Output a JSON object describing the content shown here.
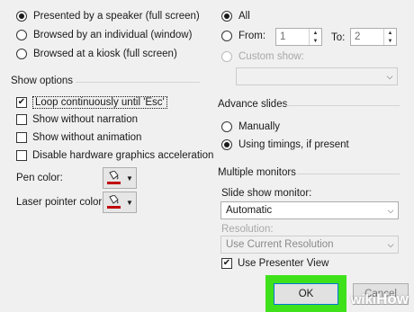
{
  "show_type": {
    "options": [
      {
        "label": "Presented by a speaker (full screen)",
        "selected": true
      },
      {
        "label": "Browsed by an individual (window)",
        "selected": false
      },
      {
        "label": "Browsed at a kiosk (full screen)",
        "selected": false
      }
    ]
  },
  "show_options": {
    "title": "Show options",
    "checks": [
      {
        "label": "Loop continuously until 'Esc'",
        "checked": true
      },
      {
        "label": "Show without narration",
        "checked": false
      },
      {
        "label": "Show without animation",
        "checked": false
      },
      {
        "label": "Disable hardware graphics acceleration",
        "checked": false
      }
    ],
    "pen_color_label": "Pen color:",
    "laser_color_label": "Laser pointer color:",
    "pen_color": "#c00000",
    "laser_color": "#c00000"
  },
  "show_slides": {
    "all_label": "All",
    "from_label": "From:",
    "from_value": "1",
    "to_label": "To:",
    "to_value": "2",
    "custom_label": "Custom show:"
  },
  "advance_slides": {
    "title": "Advance slides",
    "manually_label": "Manually",
    "timings_label": "Using timings, if present"
  },
  "monitors": {
    "title": "Multiple monitors",
    "monitor_label": "Slide show monitor:",
    "monitor_value": "Automatic",
    "resolution_label": "Resolution:",
    "resolution_value": "Use Current Resolution",
    "presenter_view_label": "Use Presenter View",
    "presenter_view_checked": true
  },
  "buttons": {
    "ok_label": "OK",
    "cancel_label": "Cancel"
  },
  "watermark": {
    "wiki": "wiki",
    "how": "How"
  },
  "colors": {
    "highlight": "#3fe21a",
    "background": "#f0f0f0"
  }
}
